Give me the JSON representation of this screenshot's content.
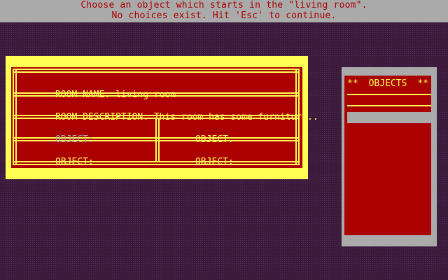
{
  "prompt": {
    "line1": "Choose an object which starts in the \"living room\".",
    "line2": "No choices exist. Hit 'Esc' to continue."
  },
  "room": {
    "name_label": "ROOM NAME:",
    "name_value": "living room",
    "description_label": "ROOM DESCRIPTION:",
    "description_value": "This room has some furniture..",
    "object_label": "OBJECT:",
    "objects": [
      "",
      "",
      "",
      ""
    ]
  },
  "objects_list": {
    "star_left": "**",
    "title": "OBJECTS",
    "star_right": "**",
    "items": []
  },
  "colors": {
    "background": "#3a1a3a",
    "bar_gray": "#aaaaaa",
    "panel_red": "#aa0000",
    "panel_yellow": "#ffff55"
  }
}
